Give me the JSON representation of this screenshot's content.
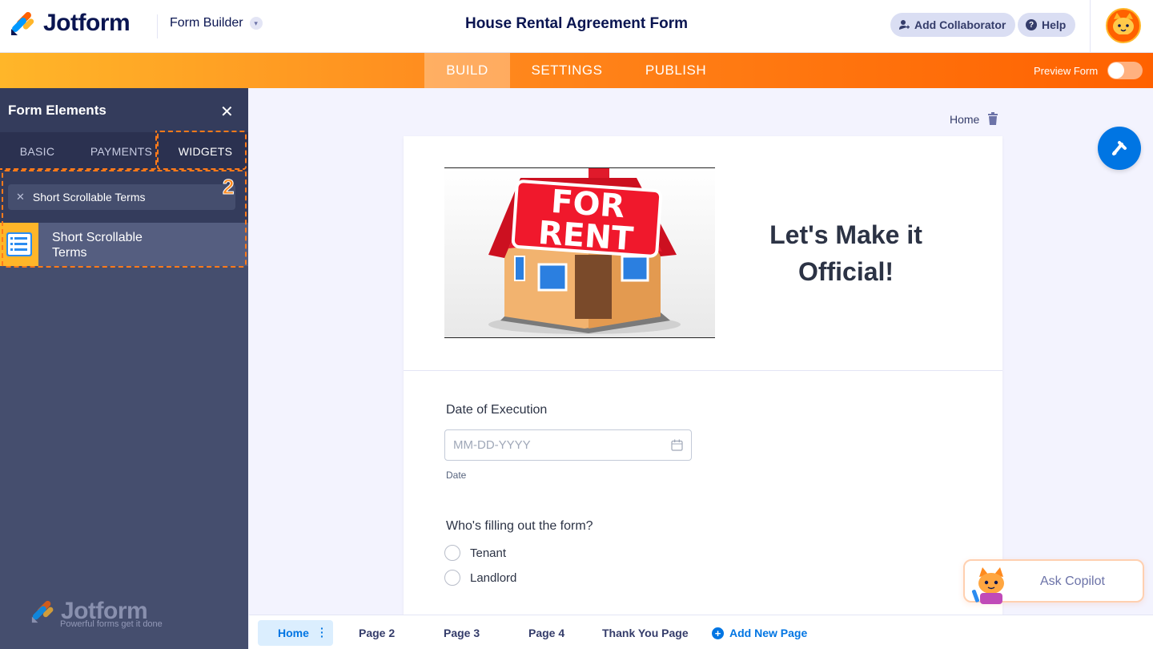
{
  "header": {
    "brand": "Jotform",
    "builder_label": "Form Builder",
    "form_title": "House Rental Agreement Form",
    "add_collaborator": "Add Collaborator",
    "help": "Help"
  },
  "nav": {
    "tabs": [
      "BUILD",
      "SETTINGS",
      "PUBLISH"
    ],
    "active": "BUILD",
    "preview_label": "Preview Form",
    "preview_on": false
  },
  "sidebar": {
    "title": "Form Elements",
    "tabs": [
      "BASIC",
      "PAYMENTS",
      "WIDGETS"
    ],
    "active_tab": "WIDGETS",
    "search_value": "Short Scrollable Terms",
    "result_label": "Short Scrollable Terms",
    "step_number": "2",
    "footer_brand": "Jotform",
    "footer_tagline": "Powerful forms get it done"
  },
  "canvas": {
    "breadcrumb": "Home",
    "header_image_text": [
      "FOR",
      "RENT"
    ],
    "header_title": "Let's Make it Official!",
    "date_label": "Date of Execution",
    "date_placeholder": "MM-DD-YYYY",
    "date_sublabel": "Date",
    "radio_question": "Who's filling out the form?",
    "radio_options": [
      "Tenant",
      "Landlord"
    ]
  },
  "pages": {
    "tabs": [
      "Home",
      "Page 2",
      "Page 3",
      "Page 4",
      "Thank You Page"
    ],
    "active": "Home",
    "add_label": "Add New Page"
  },
  "copilot": {
    "label": "Ask Copilot"
  },
  "colors": {
    "brand_orange": "#ff6100",
    "brand_yellow": "#ffb629",
    "accent_blue": "#0075e3",
    "navy": "#0a1551"
  }
}
